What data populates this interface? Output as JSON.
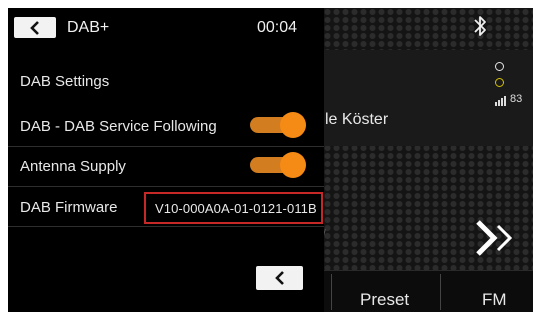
{
  "header": {
    "title": "DAB+",
    "clock": "00:04"
  },
  "settings": {
    "section_title": "DAB Settings",
    "rows": [
      {
        "label": "DAB - DAB Service Following",
        "control": "toggle",
        "on": true
      },
      {
        "label": "Antenna Supply",
        "control": "toggle",
        "on": true
      },
      {
        "label": "DAB Firmware",
        "control": "value",
        "value": "V10-000A0A-01-0121-011B"
      }
    ]
  },
  "background": {
    "artist_partial": "le Köster",
    "signal_value": "83",
    "bottom_buttons": [
      "Preset",
      "FM"
    ]
  },
  "colors": {
    "toggle_accent": "#f58a14",
    "highlight_box": "#c62828"
  },
  "icons": {
    "back": "chevron-left-icon",
    "bluetooth": "bluetooth-icon",
    "next": "double-chevron-right-icon",
    "signal": "signal-bars-icon"
  }
}
